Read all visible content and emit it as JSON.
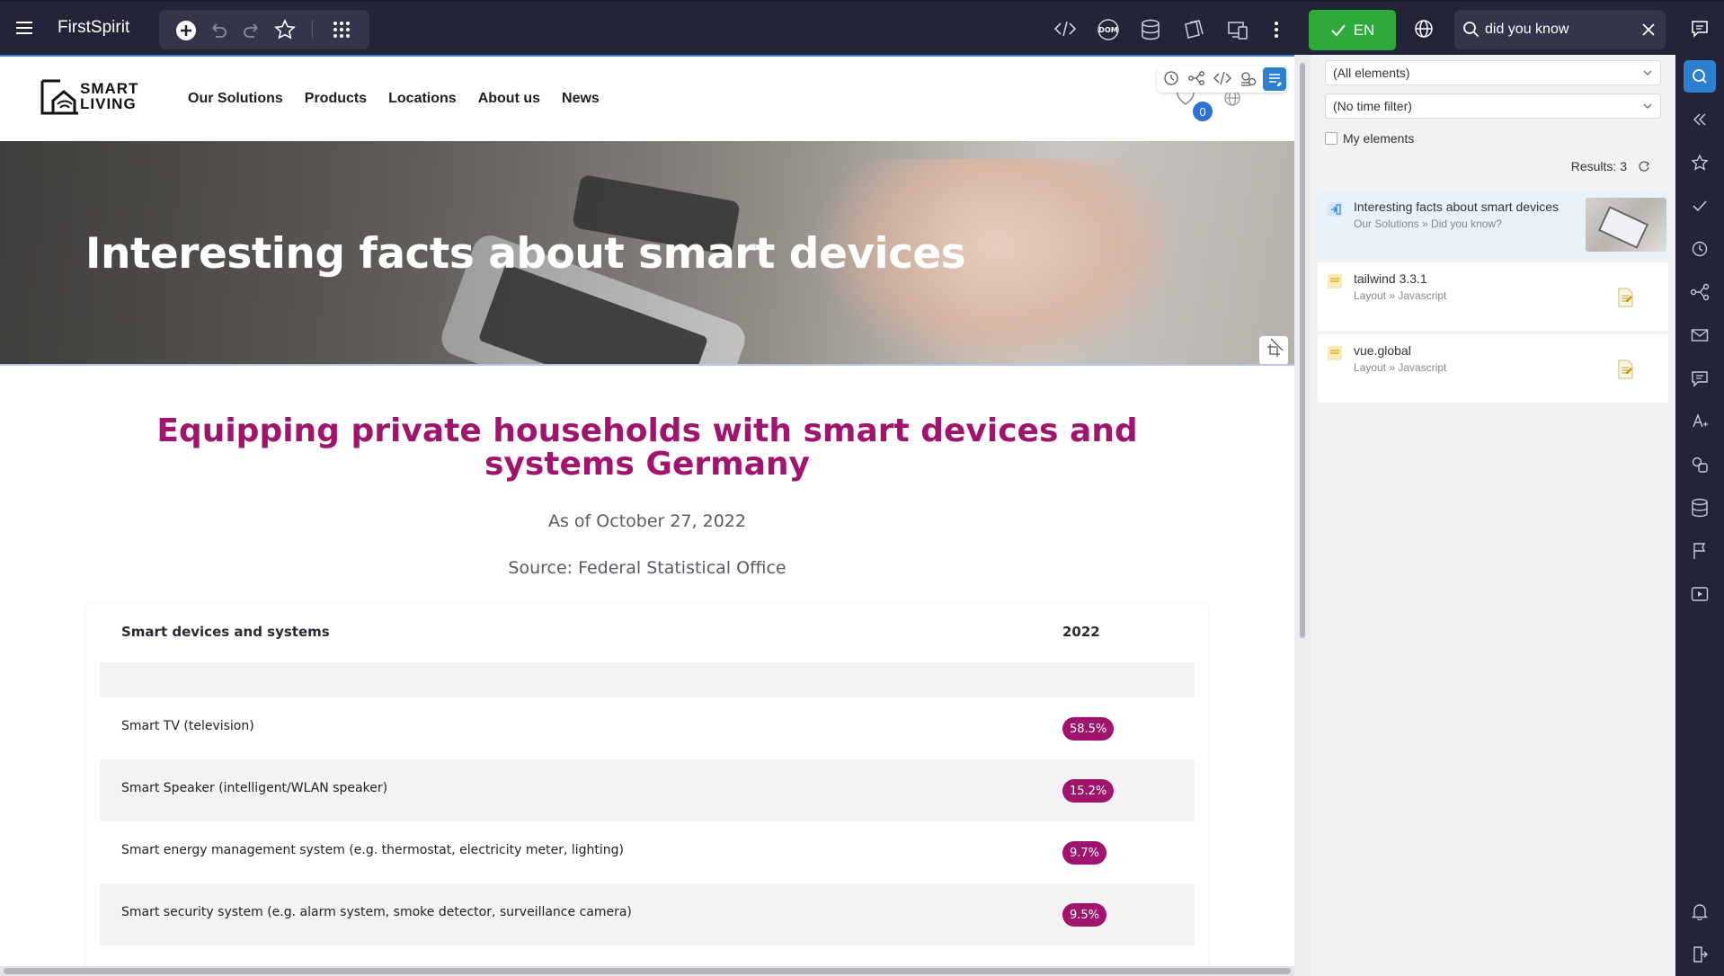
{
  "topbar": {
    "brand": "FirstSpirit",
    "lang_label": "EN",
    "search_value": "did you know",
    "search_placeholder": "Search",
    "dom_label": "DOM"
  },
  "site": {
    "logo": {
      "line1": "SMART",
      "line2": "LIVING"
    },
    "nav": [
      "Our Solutions",
      "Products",
      "Locations",
      "About us",
      "News"
    ],
    "cart_count": "0",
    "hero_title": "Interesting facts about smart devices",
    "content_title": "Equipping private households with smart devices and systems Germany",
    "date_line": "As of October 27, 2022",
    "source_line": "Source: Federal Statistical Office",
    "table": {
      "headers": [
        "Smart devices and systems",
        "2022"
      ],
      "rows": [
        {
          "label": "",
          "value": ""
        },
        {
          "label": "Smart TV (television)",
          "value": "58.5%"
        },
        {
          "label": "Smart Speaker (intelligent/WLAN speaker)",
          "value": "15.2%"
        },
        {
          "label": "Smart energy management system (e.g. thermostat, electricity meter, lighting)",
          "value": "9.7%"
        },
        {
          "label": "Smart security system (e.g. alarm system, smoke detector, surveillance camera)",
          "value": "9.5%"
        }
      ]
    }
  },
  "panel": {
    "filter_elements": "(All elements)",
    "filter_time": "(No time filter)",
    "my_elements_label": "My elements",
    "results_label": "Results: 3",
    "results": [
      {
        "title": "Interesting facts about smart devices",
        "path": "Our Solutions » Did you know?"
      },
      {
        "title": "tailwind 3.3.1",
        "path": "Layout » Javascript"
      },
      {
        "title": "vue.global",
        "path": "Layout » Javascript"
      }
    ]
  },
  "colors": {
    "topbar_bg": "#242438",
    "accent_green": "#2eaa3c",
    "accent_blue": "#2e7fd0",
    "brand_magenta": "#a0146e"
  }
}
